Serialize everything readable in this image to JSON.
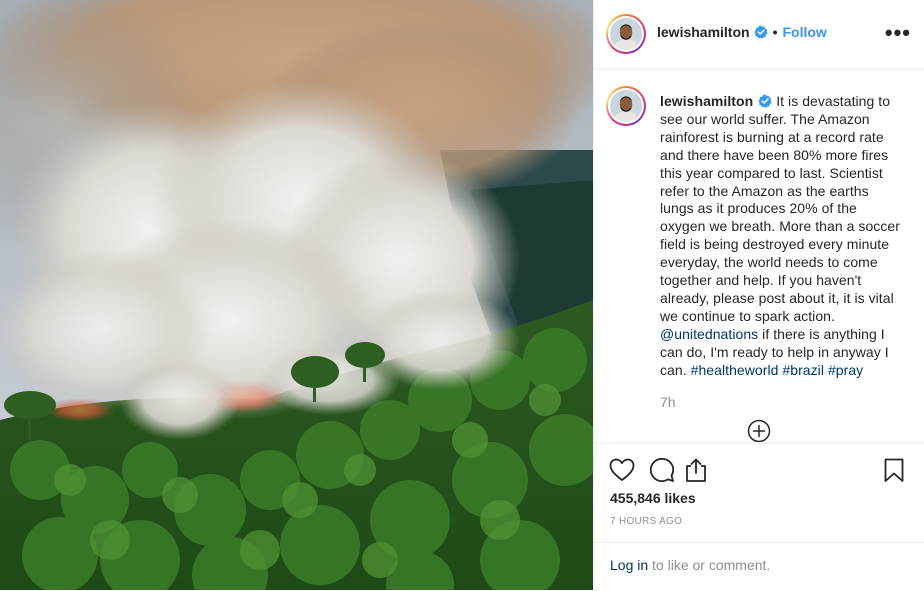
{
  "header": {
    "username": "lewishamilton",
    "dot": "•",
    "follow_label": "Follow",
    "more_label": "•••"
  },
  "caption": {
    "username": "lewishamilton",
    "text_1": "It is devastating to see our world suffer. The Amazon rainforest is burning at a record rate and there have been 80% more fires this year compared to last. Scientist refer to the Amazon as the earths lungs as it produces 20% of the oxygen we breath. More than a soccer field is being destroyed every minute everyday, the world needs to come together and help. If you haven't already, please post about it, it is vital we continue to spark action.",
    "mention": "@unitednations",
    "text_2": "if there is anything I can do, I'm ready to help in anyway I can.",
    "hashtags": [
      "#healtheworld",
      "#brazil",
      "#pray"
    ],
    "time": "7h"
  },
  "actions": {
    "likes": "455,846 likes",
    "ago": "7 HOURS AGO",
    "login_link": "Log in",
    "login_rest": "to like or comment."
  },
  "icons": {
    "verified": "verified-badge-icon",
    "like": "heart-icon",
    "comment": "comment-icon",
    "share": "share-icon",
    "save": "bookmark-icon",
    "load_more": "plus-circle-icon"
  },
  "colors": {
    "link_blue": "#3897f0",
    "dark_link": "#003569",
    "muted": "#8e8e8e",
    "text": "#262626"
  }
}
